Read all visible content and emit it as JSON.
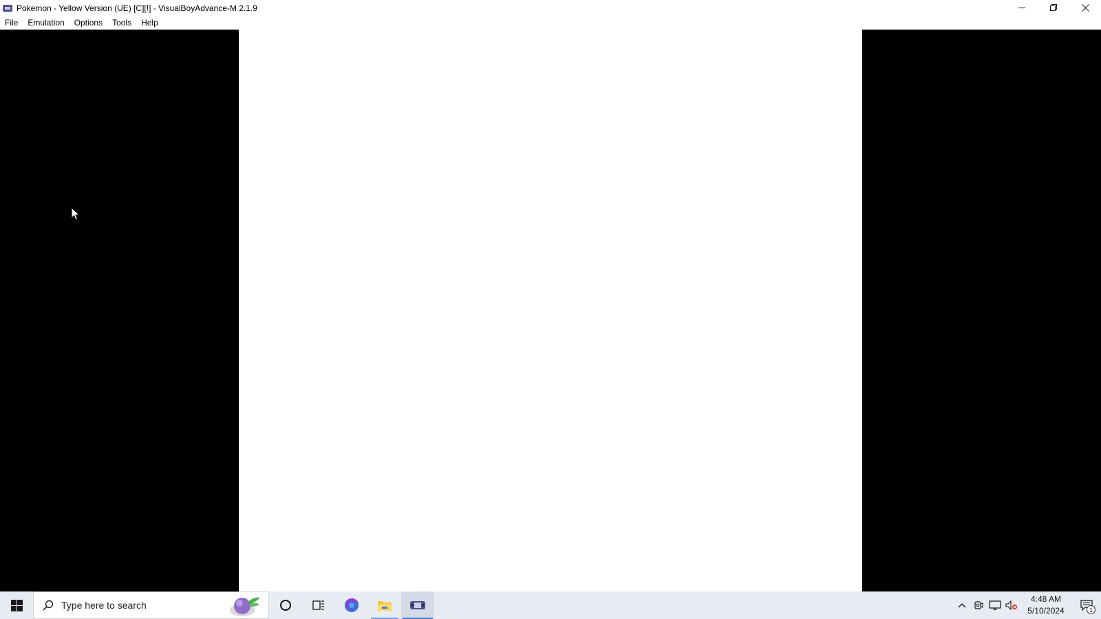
{
  "window": {
    "title": "Pokemon - Yellow Version (UE) [C][!] - VisualBoyAdvance-M 2.1.9",
    "minimize_icon": "minimize-icon",
    "maximize_icon": "restore-icon",
    "close_icon": "close-icon"
  },
  "menu": {
    "items": [
      "File",
      "Emulation",
      "Options",
      "Tools",
      "Help"
    ]
  },
  "taskbar": {
    "search_placeholder": "Type here to search",
    "pinned": [
      "cortana-icon",
      "task-view-icon",
      "firefox-icon",
      "file-explorer-icon",
      "visualboyadvance-icon"
    ],
    "tray": {
      "time": "4:48 AM",
      "date": "5/10/2024",
      "notification_count": "1"
    }
  },
  "colors": {
    "emu_background": "#000000",
    "emu_screen": "#ffffff",
    "taskbar": "#e8ecf2",
    "accent": "#3a7bd5"
  }
}
